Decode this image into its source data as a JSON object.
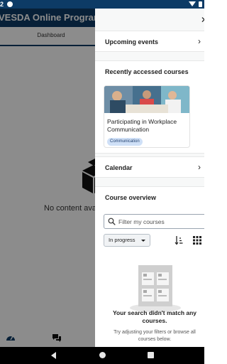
{
  "status_bar": {
    "time": "2"
  },
  "app": {
    "title": "VESDA Online Program",
    "tabs": [
      {
        "label": "Dashboard",
        "active": true
      }
    ],
    "empty_message": "No content avai"
  },
  "drawer": {
    "upcoming_events": {
      "title": "Upcoming events"
    },
    "recently_accessed": {
      "title": "Recently accessed courses",
      "course": {
        "name": "Participating in Workplace Communication",
        "category": "Communication"
      }
    },
    "calendar": {
      "title": "Calendar"
    },
    "course_overview": {
      "title": "Course overview",
      "search_placeholder": "Filter my courses",
      "filter_value": "In progress",
      "empty_title": "Your search didn't match any courses.",
      "empty_text": "Try adjusting your filters or browse all courses below."
    }
  },
  "colors": {
    "primary": "#0d3b66",
    "tag_bg": "#cfe0f7",
    "drawer_bg": "#f7f8f8"
  },
  "icons": [
    "close-icon",
    "chevron-right-icon",
    "search-icon",
    "sort-icon",
    "grid-icon",
    "dashboard-icon",
    "chat-icon"
  ]
}
